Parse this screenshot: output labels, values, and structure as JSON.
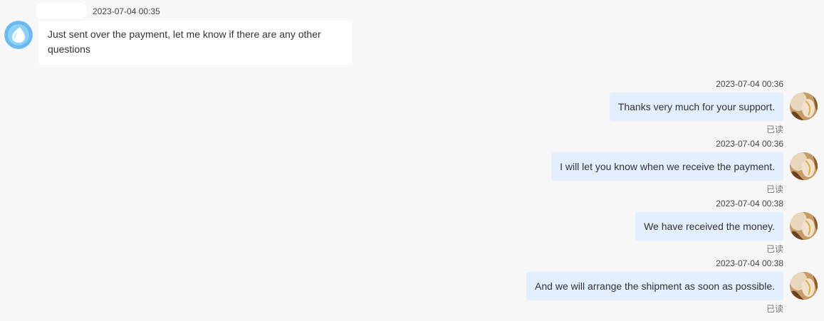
{
  "incoming": {
    "timestamp": "2023-07-04 00:35",
    "text": "Just sent over the payment, let me know if there are any other questions",
    "avatar_icon": "droplet-icon",
    "colors": {
      "avatar": "#7cc4f2",
      "bubble": "#ffffff"
    }
  },
  "outgoing": [
    {
      "timestamp": "2023-07-04 00:36",
      "text": "Thanks very much for your support.",
      "status": "已读"
    },
    {
      "timestamp": "2023-07-04 00:36",
      "text": "I will let you know when we receive the payment.",
      "status": "已读"
    },
    {
      "timestamp": "2023-07-04 00:38",
      "text": "We have received the money.",
      "status": "已读"
    },
    {
      "timestamp": "2023-07-04 00:38",
      "text": "And we will arrange the shipment as soon as possible.",
      "status": "已读"
    }
  ],
  "colors": {
    "background": "#f7f7f7",
    "outgoing_bubble": "#e3efff"
  }
}
